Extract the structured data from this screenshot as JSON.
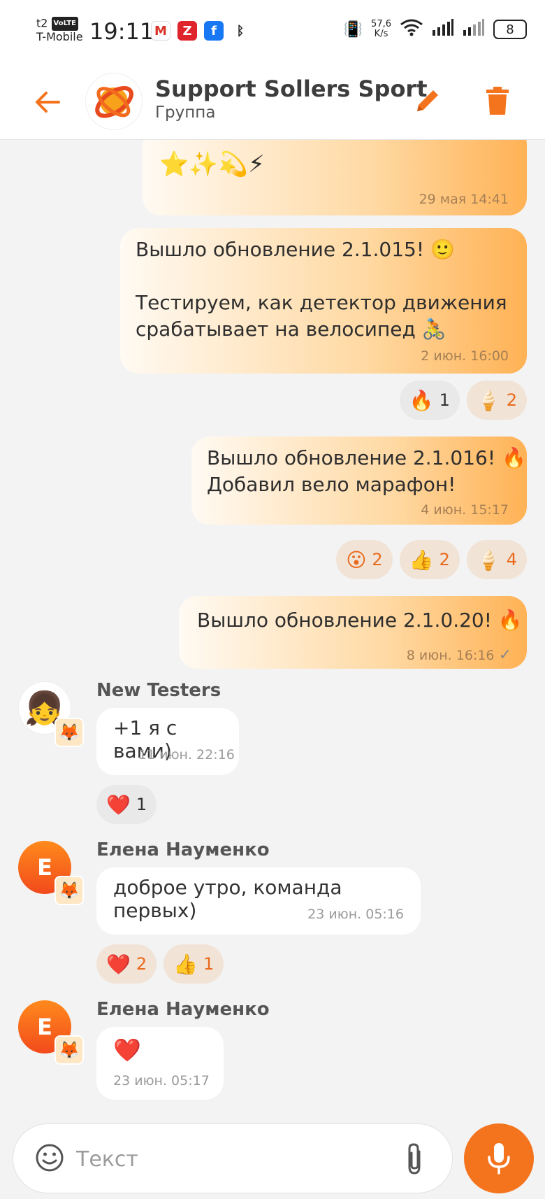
{
  "status_bar": {
    "carrier_top": "t2",
    "volte": "VoLTE",
    "carrier_bottom": "T-Mobile",
    "time": "19:11",
    "net_speed_value": "57,6",
    "net_speed_unit": "K/s",
    "battery": "8"
  },
  "header": {
    "title": "Support Sollers Sport",
    "subtitle": "Группа"
  },
  "messages_out": [
    {
      "text": "⭐✨💫⚡",
      "time": "29 мая 14:41"
    },
    {
      "text": "Вышло обновление 2.1.015! 🙂\n\nТестируем, как детектор движения\nсрабатывает на велосипед 🚴",
      "time": "2 июн. 16:00"
    },
    {
      "text": "Вышло обновление 2.1.016! 🔥\nДобавил вело марафон!",
      "time": "4 июн. 15:17"
    },
    {
      "text": "Вышло обновление 2.1.0.20! 🔥",
      "time": "8 июн. 16:16",
      "status": "✓"
    }
  ],
  "reactions_out": [
    [
      {
        "emoji": "🔥",
        "count": "1"
      },
      {
        "emoji": "🍦",
        "count": "2"
      }
    ],
    [
      {
        "emoji": "😮",
        "count": "2"
      },
      {
        "emoji": "👍",
        "count": "2"
      },
      {
        "emoji": "🍦",
        "count": "4"
      }
    ]
  ],
  "messages_in": [
    {
      "sender": "New Testers",
      "text": "+1 я с вами)",
      "time": "11 июн. 22:16",
      "reactions": [
        {
          "emoji": "❤️",
          "count": "1"
        }
      ]
    },
    {
      "sender": "Елена Науменко",
      "avatar_letter": "Е",
      "text": "доброе утро, команда первых)",
      "time": "23 июн. 05:16",
      "reactions": [
        {
          "emoji": "❤️",
          "count": "2"
        },
        {
          "emoji": "👍",
          "count": "1"
        }
      ]
    },
    {
      "sender": "Елена Науменко",
      "avatar_letter": "Е",
      "text": "❤️",
      "time": "23 июн. 05:17"
    }
  ],
  "composer": {
    "placeholder": "Текст"
  },
  "colors": {
    "accent": "#f4731d",
    "bubble_out_end": "#ffb255",
    "reaction_bg": "#f1e3d6"
  }
}
